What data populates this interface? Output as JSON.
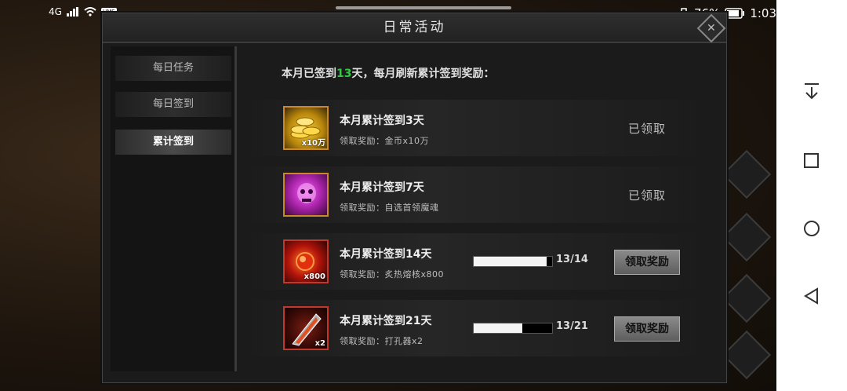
{
  "status_bar": {
    "network": "4G",
    "badge": "HMS",
    "battery": "76%",
    "time": "1:03"
  },
  "dialog": {
    "title": "日常活动",
    "close_icon": "close-icon"
  },
  "sidebar": {
    "items": [
      {
        "label": "每日任务",
        "active": false
      },
      {
        "label": "每日签到",
        "active": false
      },
      {
        "label": "累计签到",
        "active": true
      }
    ]
  },
  "summary": {
    "prefix": "本月已签到",
    "days": "13",
    "suffix": "天，每月刷新累计签到奖励："
  },
  "rewards": [
    {
      "title": "本月累计签到3天",
      "reward": "领取奖励：金币x10万",
      "qty": "x10万",
      "icon": "gold-coins-icon",
      "status": "已领取"
    },
    {
      "title": "本月累计签到7天",
      "reward": "领取奖励：自选首领魔魂",
      "qty": "",
      "icon": "purple-skull-icon",
      "status": "已领取"
    },
    {
      "title": "本月累计签到14天",
      "reward": "领取奖励：炙热熔核x800",
      "qty": "x800",
      "icon": "fire-core-icon",
      "progress": "13/14",
      "progress_value": 0.93,
      "button": "领取奖励"
    },
    {
      "title": "本月累计签到21天",
      "reward": "领取奖励：打孔器x2",
      "qty": "x2",
      "icon": "drill-icon",
      "progress": "13/21",
      "progress_value": 0.62,
      "button": "领取奖励"
    }
  ],
  "colors": {
    "highlight": "#2ecc40",
    "icon_border": "#c9892a"
  }
}
